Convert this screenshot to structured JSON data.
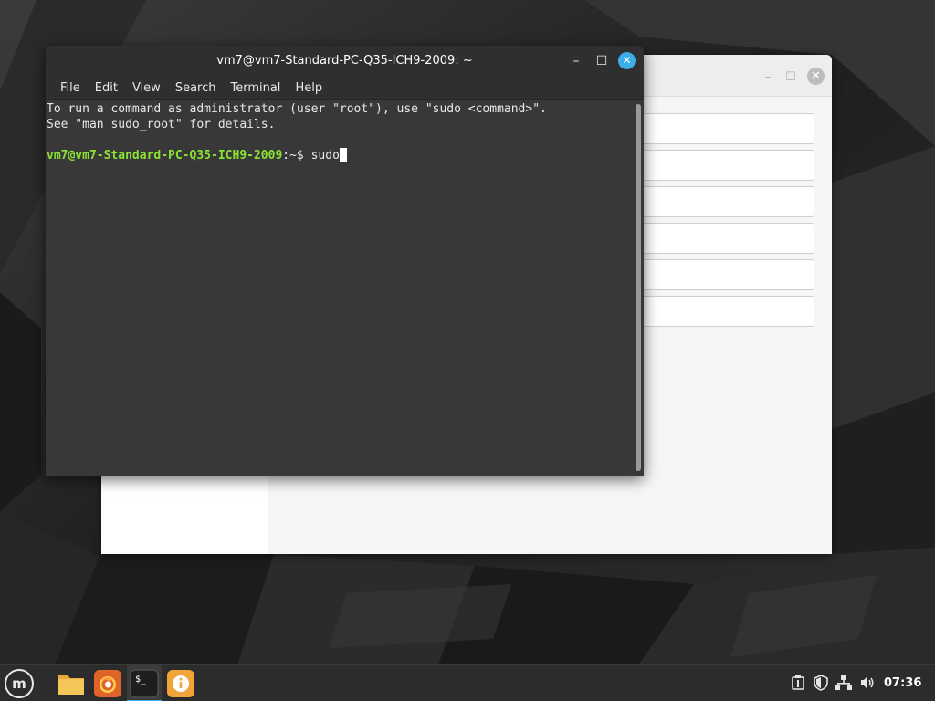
{
  "terminal": {
    "title": "vm7@vm7-Standard-PC-Q35-ICH9-2009: ~",
    "menu": [
      "File",
      "Edit",
      "View",
      "Search",
      "Terminal",
      "Help"
    ],
    "lines": [
      "To run a command as administrator (user \"root\"), use \"sudo <command>\".",
      "See \"man sudo_root\" for details."
    ],
    "prompt_user": "vm7@vm7-Standard-PC-Q35-ICH9-2009",
    "prompt_sep": ":~$ ",
    "command": "sudo",
    "minimize_glyph": "–",
    "maximize_glyph": "☐",
    "close_glyph": "✕"
  },
  "background_window": {
    "minimize_glyph": "–",
    "maximize_glyph": "☐",
    "close_glyph": "✕"
  },
  "taskbar": {
    "menu_logo": "m",
    "launchers": [
      {
        "name": "files-icon",
        "color": "#f0c14a"
      },
      {
        "name": "firefox-icon",
        "color": "#e0642a"
      },
      {
        "name": "terminal-icon",
        "color": "#1e1e1e",
        "glyph": "$_"
      },
      {
        "name": "info-icon",
        "color": "#f1a43a",
        "glyph": "i"
      }
    ],
    "clock": "07:36"
  },
  "colors": {
    "accent": "#3daee9",
    "prompt_green": "#8ae234"
  }
}
